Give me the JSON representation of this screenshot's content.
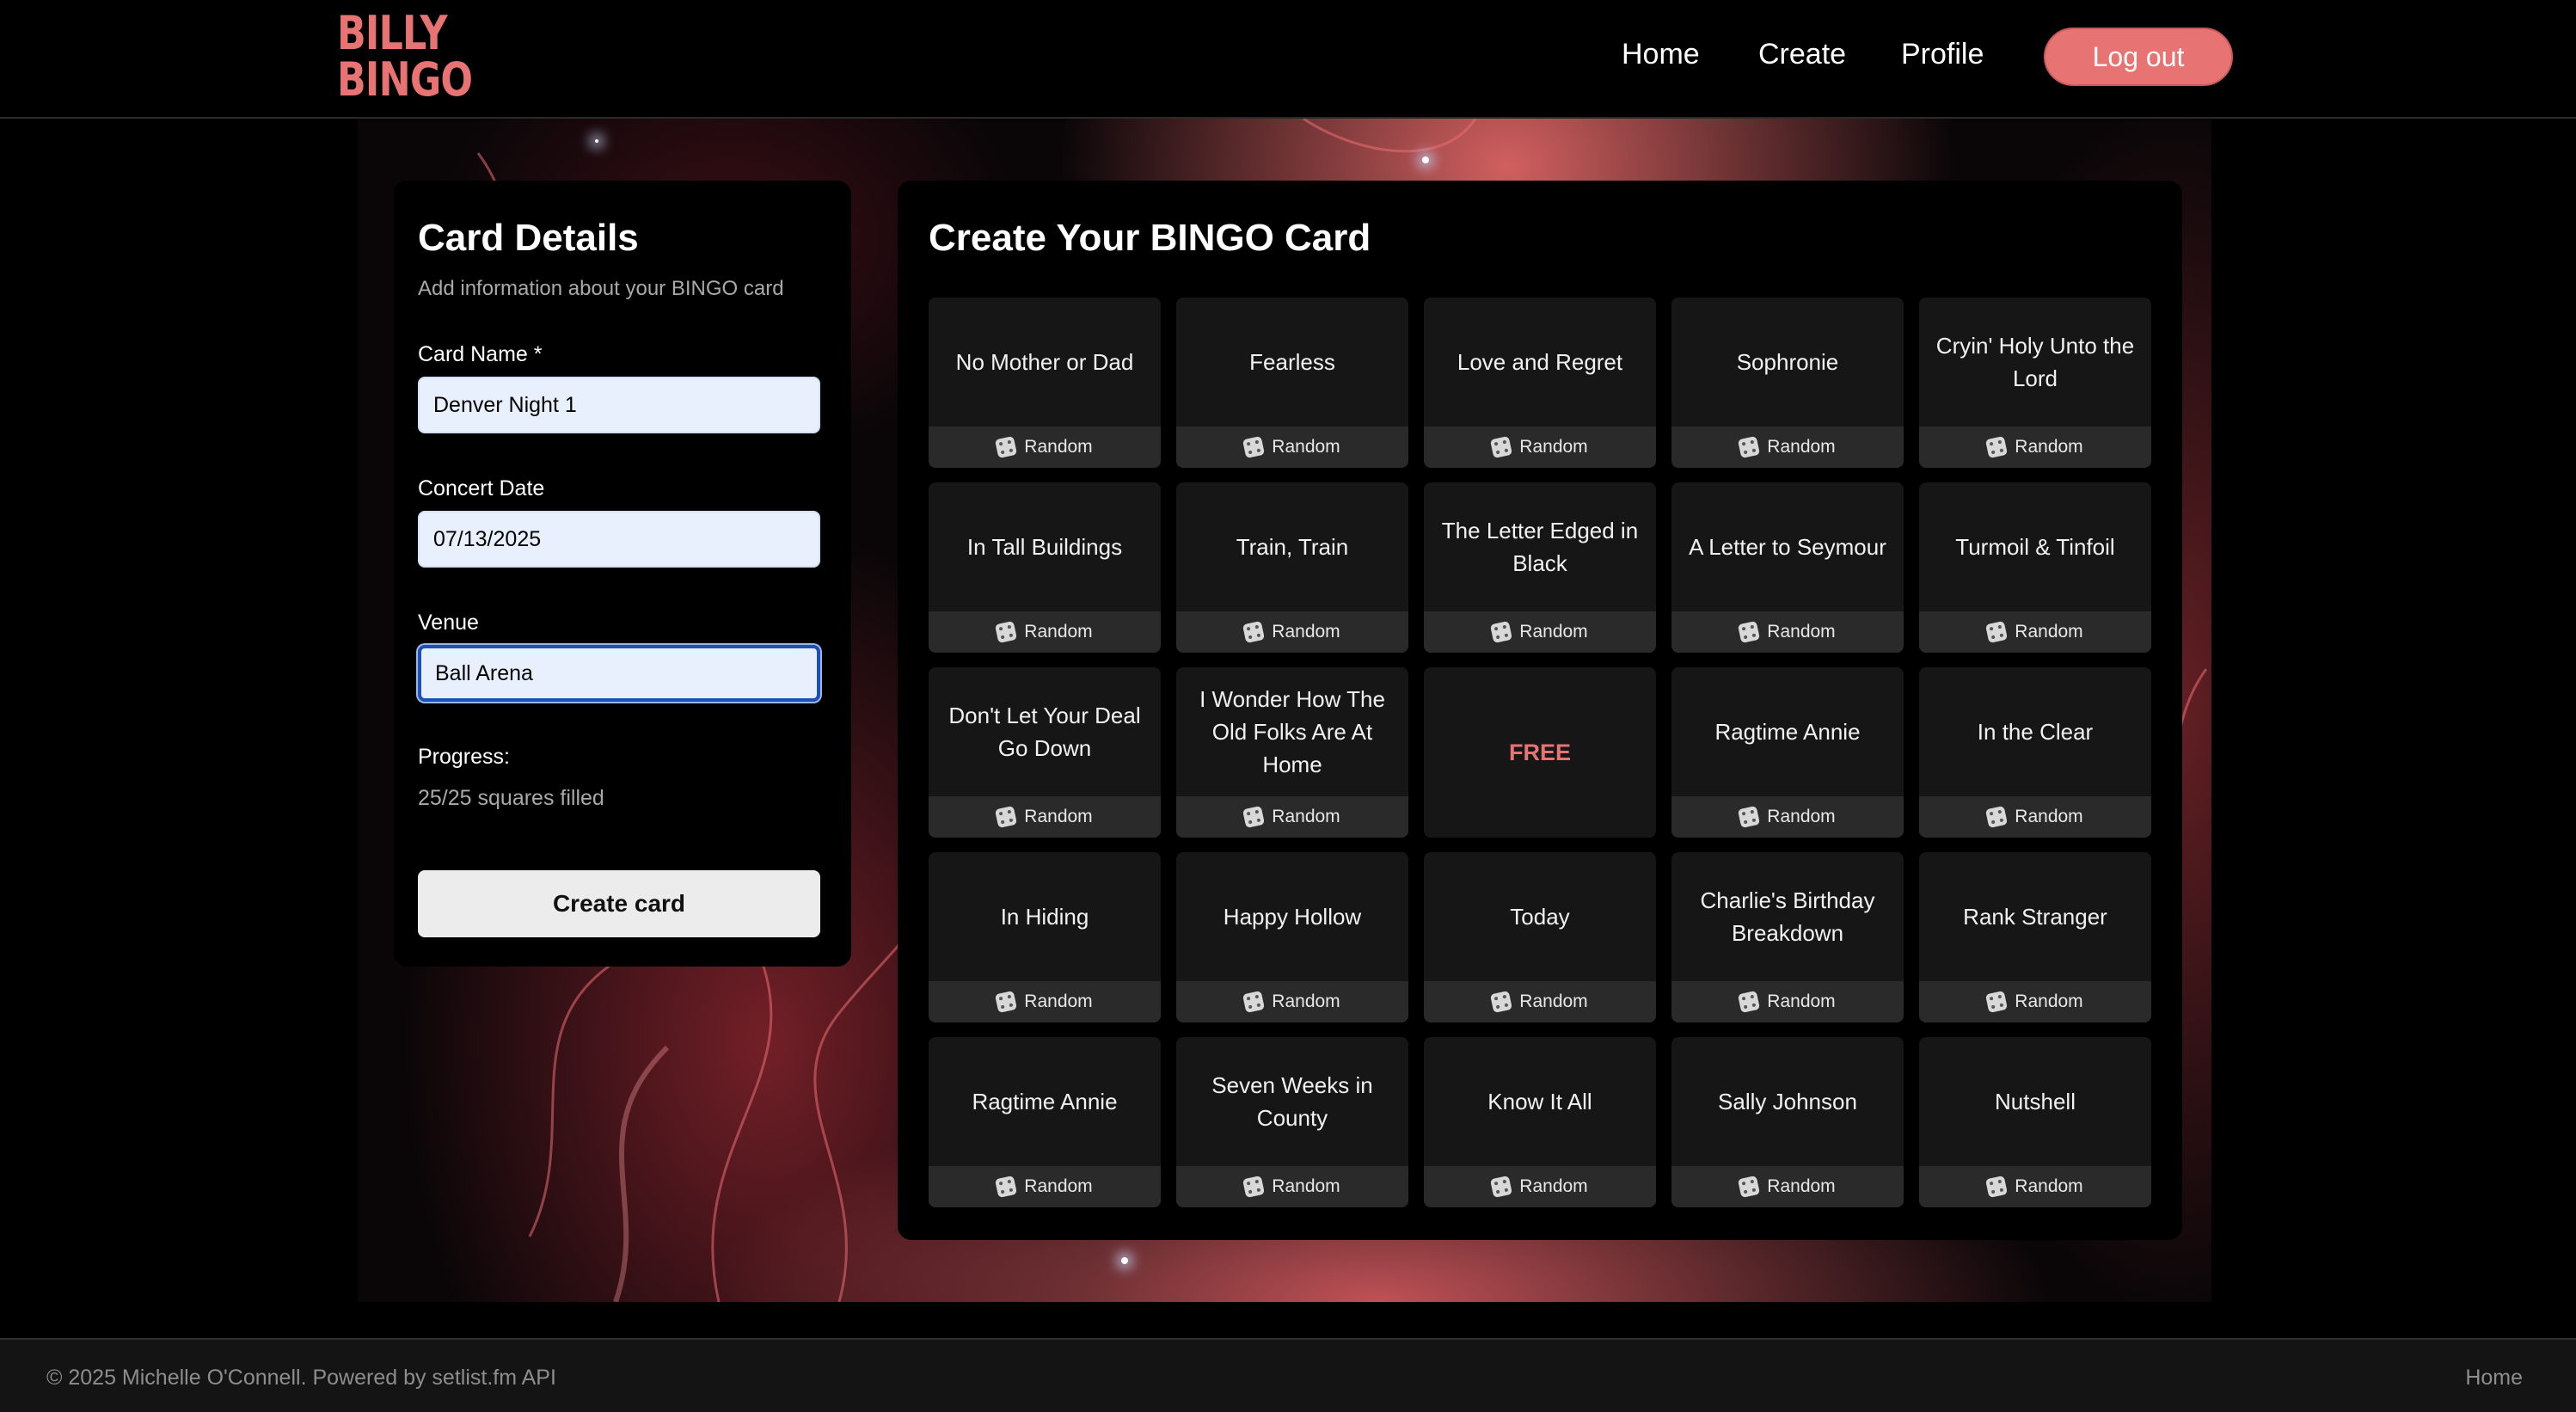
{
  "header": {
    "logo_line1": "BILLY",
    "logo_line2": "BINGO",
    "nav": {
      "home": "Home",
      "create": "Create",
      "profile": "Profile"
    },
    "logout_label": "Log out"
  },
  "details": {
    "title": "Card Details",
    "subtitle": "Add information about your BINGO card",
    "card_name_label": "Card Name *",
    "card_name_value": "Denver Night 1",
    "date_label": "Concert Date",
    "date_value": "07/13/2025",
    "venue_label": "Venue",
    "venue_value": "Ball Arena",
    "progress_label": "Progress:",
    "progress_text": "25/25 squares filled",
    "progress_filled": 25,
    "progress_total": 25,
    "create_label": "Create card"
  },
  "bingo": {
    "title": "Create Your BINGO Card",
    "random_label": "Random",
    "free_label": "FREE",
    "cells": [
      "No Mother or Dad",
      "Fearless",
      "Love and Regret",
      "Sophronie",
      "Cryin' Holy Unto the Lord",
      "In Tall Buildings",
      "Train, Train",
      "The Letter Edged in Black",
      "A Letter to Seymour",
      "Turmoil & Tinfoil",
      "Don't Let Your Deal Go Down",
      "I Wonder How The Old Folks Are At Home",
      "FREE",
      "Ragtime Annie",
      "In the Clear",
      "In Hiding",
      "Happy Hollow",
      "Today",
      "Charlie's Birthday Breakdown",
      "Rank Stranger",
      "Ragtime Annie",
      "Seven Weeks in County",
      "Know It All",
      "Sally Johnson",
      "Nutshell"
    ]
  },
  "footer": {
    "copyright": "© 2025 Michelle O'Connell. Powered by setlist.fm API",
    "home_link": "Home"
  },
  "colors": {
    "accent": "#e77373",
    "panel": "#000000",
    "cell": "#161616",
    "random_bar": "#2a2a2a",
    "input_bg": "#e8f0fe",
    "focus": "#1e4fb5"
  }
}
